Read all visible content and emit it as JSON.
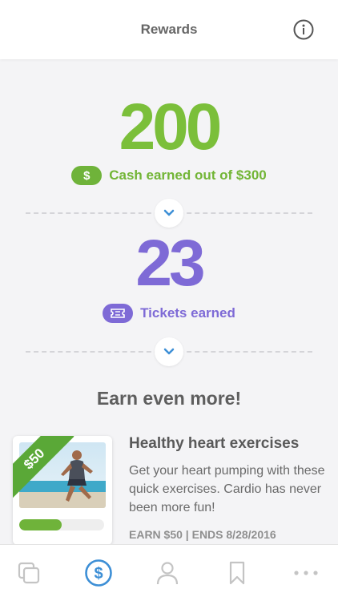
{
  "header": {
    "title": "Rewards",
    "info_icon": "info-icon"
  },
  "cash": {
    "amount": "200",
    "pill_symbol": "$",
    "label": "Cash earned out of $300",
    "color": "#7bbf3a"
  },
  "tickets": {
    "amount": "23",
    "label": "Tickets earned",
    "color": "#7e6ad6"
  },
  "section_title": "Earn even more!",
  "offer": {
    "ribbon": "$50",
    "title": "Healthy heart exercises",
    "description": "Get your heart pumping with these quick exercises. Cardio has never been more fun!",
    "meta": "EARN $50 | ENDS 8/28/2016",
    "progress": 0.5
  },
  "tabbar": {
    "items": [
      {
        "icon": "copy-icon",
        "active": false
      },
      {
        "icon": "dollar-circle-icon",
        "active": true
      },
      {
        "icon": "person-icon",
        "active": false
      },
      {
        "icon": "bookmark-icon",
        "active": false
      },
      {
        "icon": "more-icon",
        "active": false
      }
    ],
    "active_color": "#3d8fd6"
  }
}
